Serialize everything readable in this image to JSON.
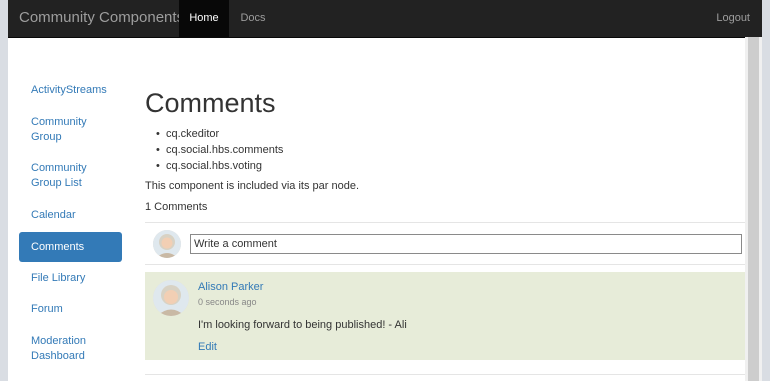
{
  "navbar": {
    "brand": "Community Components",
    "tabs": [
      {
        "label": "Home",
        "active": true
      },
      {
        "label": "Docs",
        "active": false
      }
    ],
    "logout": "Logout"
  },
  "sidebar": {
    "items": [
      {
        "label": "ActivityStreams"
      },
      {
        "label": "Community Group"
      },
      {
        "label": "Community Group List"
      },
      {
        "label": "Calendar"
      },
      {
        "label": "Comments",
        "active": true
      },
      {
        "label": "File Library"
      },
      {
        "label": "Forum"
      },
      {
        "label": "Moderation Dashboard"
      }
    ]
  },
  "main": {
    "title": "Comments",
    "dependencies": [
      "cq.ckeditor",
      "cq.social.hbs.comments",
      "cq.social.hbs.voting"
    ],
    "included_text": "This component is included via its par node.",
    "comment_count": "1 Comments",
    "composer": {
      "value": "Write a comment"
    },
    "comments": [
      {
        "author": "Alison Parker",
        "timestamp": "0 seconds ago",
        "body": "I'm looking forward to being published! - Ali",
        "edit_label": "Edit"
      }
    ]
  },
  "colors": {
    "navbar_bg": "#222222",
    "link": "#337ab7",
    "active_item_bg": "#337ab7",
    "comment_bg": "#e7ecd9"
  }
}
